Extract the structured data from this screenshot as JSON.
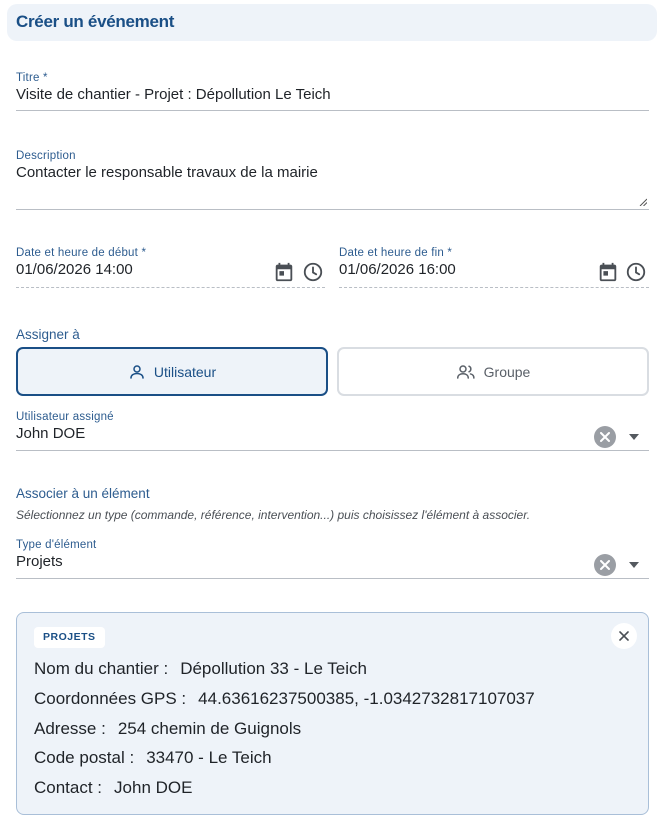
{
  "header": {
    "title": "Créer un événement"
  },
  "form": {
    "title": {
      "label": "Titre *",
      "value": "Visite de chantier - Projet : Dépollution Le Teich"
    },
    "description": {
      "label": "Description",
      "value": "Contacter le responsable travaux de la mairie"
    },
    "start": {
      "label": "Date et heure de début *",
      "value": "01/06/2026 14:00"
    },
    "end": {
      "label": "Date et heure de fin *",
      "value": "01/06/2026 16:00"
    },
    "assign": {
      "label": "Assigner à",
      "options": [
        {
          "label": "Utilisateur",
          "icon": "user-icon",
          "active": true
        },
        {
          "label": "Groupe",
          "icon": "group-icon",
          "active": false
        }
      ]
    },
    "assigned_user": {
      "label": "Utilisateur assigné",
      "value": "John DOE"
    },
    "associate": {
      "label": "Associer à un élément",
      "helper": "Sélectionnez un type (commande, référence, intervention...) puis choisissez l'élément à associer."
    },
    "element_type": {
      "label": "Type d'élément",
      "value": "Projets"
    }
  },
  "card": {
    "badge": "PROJETS",
    "rows": [
      {
        "key": "Nom du chantier :",
        "value": "Dépollution 33 - Le Teich"
      },
      {
        "key": "Coordonnées GPS :",
        "value": "44.63616237500385, -1.0342732817107037"
      },
      {
        "key": "Adresse :",
        "value": "254 chemin de Guignols"
      },
      {
        "key": "Code postal :",
        "value": "33470 - Le Teich"
      },
      {
        "key": "Contact :",
        "value": "John DOE"
      }
    ]
  },
  "colors": {
    "accent": "#1a4f86",
    "panel": "#eef3f9",
    "border": "#a9bfd8"
  }
}
